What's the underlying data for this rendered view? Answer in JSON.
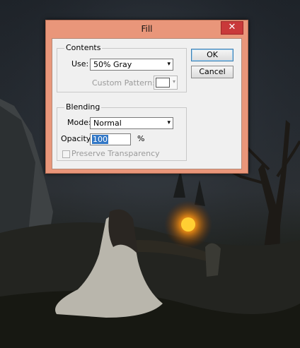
{
  "dialog": {
    "title": "Fill",
    "close_glyph": "✕",
    "ok_label": "OK",
    "cancel_label": "Cancel"
  },
  "contents": {
    "legend": "Contents",
    "use_label": "Use:",
    "use_value": "50% Gray",
    "custom_pattern_label": "Custom Pattern:"
  },
  "blending": {
    "legend": "Blending",
    "mode_label": "Mode:",
    "mode_value": "Normal",
    "opacity_label": "Opacity:",
    "opacity_value": "100",
    "opacity_unit": "%",
    "preserve_label": "Preserve Transparency",
    "preserve_checked": false
  },
  "icons": {
    "dropdown": "▾"
  },
  "colors": {
    "titlebar": "#e9967a",
    "close": "#c9393a"
  }
}
